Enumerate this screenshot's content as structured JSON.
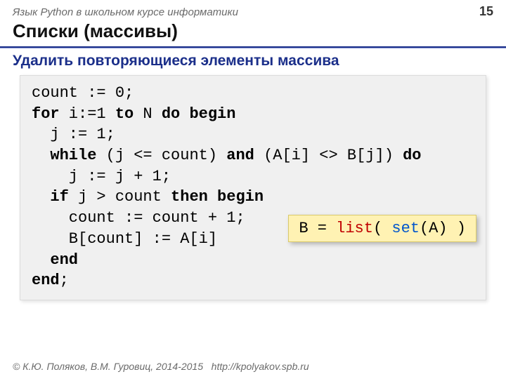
{
  "header": {
    "course": "Язык Python в школьном курсе информатики",
    "page": "15"
  },
  "title": "Списки (массивы)",
  "subtitle": "Удалить повторяющиеся элементы массива",
  "code": {
    "l1a": "count := 0;",
    "l2a": "for",
    "l2b": " i:=1 ",
    "l2c": "to",
    "l2d": " N ",
    "l2e": "do begin",
    "l3a": "  j := 1;",
    "l4a": "  ",
    "l4b": "while",
    "l4c": " (j <= count) ",
    "l4d": "and",
    "l4e": " (A[i] <> B[j]) ",
    "l4f": "do",
    "l5a": "    j := j + 1;",
    "l6a": "  ",
    "l6b": "if",
    "l6c": " j > count ",
    "l6d": "then begin",
    "l7a": "    count := count + 1;",
    "l8a": "    B[count] := A[i]",
    "l9a": "  ",
    "l9b": "end",
    "l10a": "end",
    "l10b": ";"
  },
  "callout": {
    "pre": "B = ",
    "fn1": "list",
    "mid": "( ",
    "fn2": "set",
    "post": "(A) )"
  },
  "footer": {
    "copyright": "© К.Ю. Поляков, В.М. Гуровиц, 2014-2015",
    "url": "http://kpolyakov.spb.ru"
  }
}
